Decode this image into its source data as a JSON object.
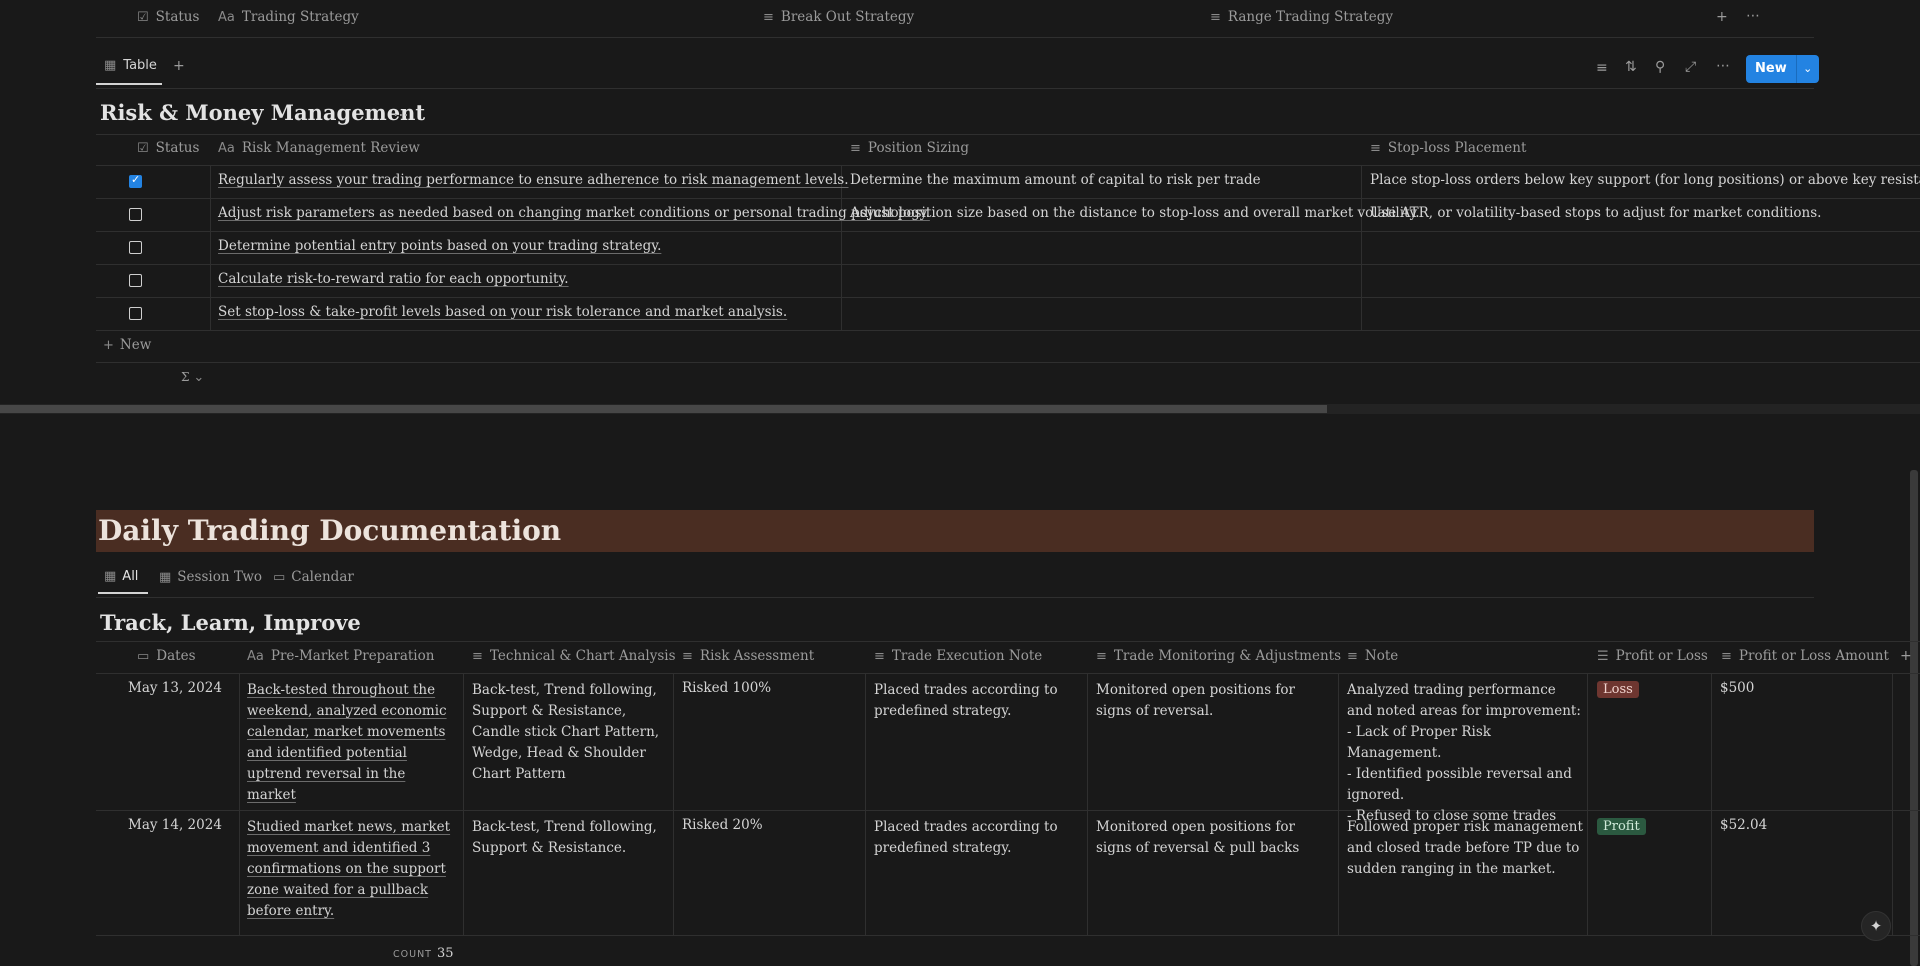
{
  "top_header": {
    "status": "Status",
    "trading_strategy": "Trading Strategy",
    "break_out": "Break Out Strategy",
    "range": "Range Trading Strategy"
  },
  "view_bar": {
    "tab": "Table",
    "new_label": "New"
  },
  "risk": {
    "title": "Risk & Money Management",
    "columns": {
      "status": "Status",
      "review": "Risk Management Review",
      "sizing": "Position Sizing",
      "stoploss": "Stop-loss Placement"
    },
    "rows": [
      {
        "checked": true,
        "review": "Regularly assess your trading performance to ensure adherence to risk management levels.",
        "sizing": "Determine the maximum amount of capital to risk per trade",
        "stoploss": "Place stop-loss orders below key support (for long positions) or above key resistance (for sh"
      },
      {
        "checked": false,
        "review": "Adjust risk parameters as needed based on changing market conditions or personal trading psychology.",
        "sizing": "Adjust position size based on the distance to stop-loss and overall market volatility.",
        "stoploss": "Use ATR, or volatility-based stops to adjust for market conditions."
      },
      {
        "checked": false,
        "review": "Determine potential entry points based on your trading strategy.",
        "sizing": "",
        "stoploss": ""
      },
      {
        "checked": false,
        "review": "Calculate risk-to-reward ratio for each opportunity.",
        "sizing": "",
        "stoploss": ""
      },
      {
        "checked": false,
        "review": "Set stop-loss & take-profit levels based on your risk tolerance and market analysis.",
        "sizing": "",
        "stoploss": ""
      }
    ],
    "new_row": "New",
    "sigma": "Σ"
  },
  "daily": {
    "banner": "Daily Trading Documentation",
    "tabs": [
      "All",
      "Session Two",
      "Calendar"
    ],
    "title": "Track, Learn, Improve",
    "columns": {
      "dates": "Dates",
      "prep": "Pre-Market Preparation",
      "tech": "Technical & Chart Analysis",
      "risk": "Risk Assessment",
      "exec": "Trade Execution Note",
      "monitor": "Trade Monitoring & Adjustments",
      "note": "Note",
      "pl": "Profit or Loss",
      "amount": "Profit or Loss Amount"
    },
    "rows": [
      {
        "date": "May 13, 2024",
        "prep": "Back-tested throughout the weekend, analyzed economic calendar, market movements and identified potential uptrend reversal in the market",
        "tech": "Back-test, Trend following, Support & Resistance, Candle stick Chart Pattern, Wedge, Head & Shoulder Chart Pattern",
        "risk": "Risked 100%",
        "exec": "Placed trades according to predefined strategy.",
        "monitor": "Monitored open positions for signs of reversal.",
        "note": [
          "Analyzed trading performance and noted areas for improvement:",
          "- Lack of Proper Risk Management.",
          "- Identified possible reversal and ignored.",
          "- Refused to close some trades"
        ],
        "pl": "Loss",
        "amount": "$500"
      },
      {
        "date": "May 14, 2024",
        "prep": "Studied market news,  market movement and identified 3 confirmations on the support zone waited for a pullback before entry.",
        "tech": "Back-test, Trend following, Support & Resistance.",
        "risk": "Risked 20%",
        "exec": "Placed trades according to predefined strategy.",
        "monitor": "Monitored open positions for signs of reversal & pull backs",
        "note": [
          "Followed proper risk management and closed trade before TP due to sudden ranging in the market."
        ],
        "pl": "Profit",
        "amount": "$52.04"
      }
    ],
    "count_label": "COUNT",
    "count_value": "35"
  },
  "colors": {
    "background": "#191919",
    "accent": "#2383e2",
    "banner": "#4a2d22",
    "loss": "#6e3630",
    "profit": "#2b5940"
  }
}
